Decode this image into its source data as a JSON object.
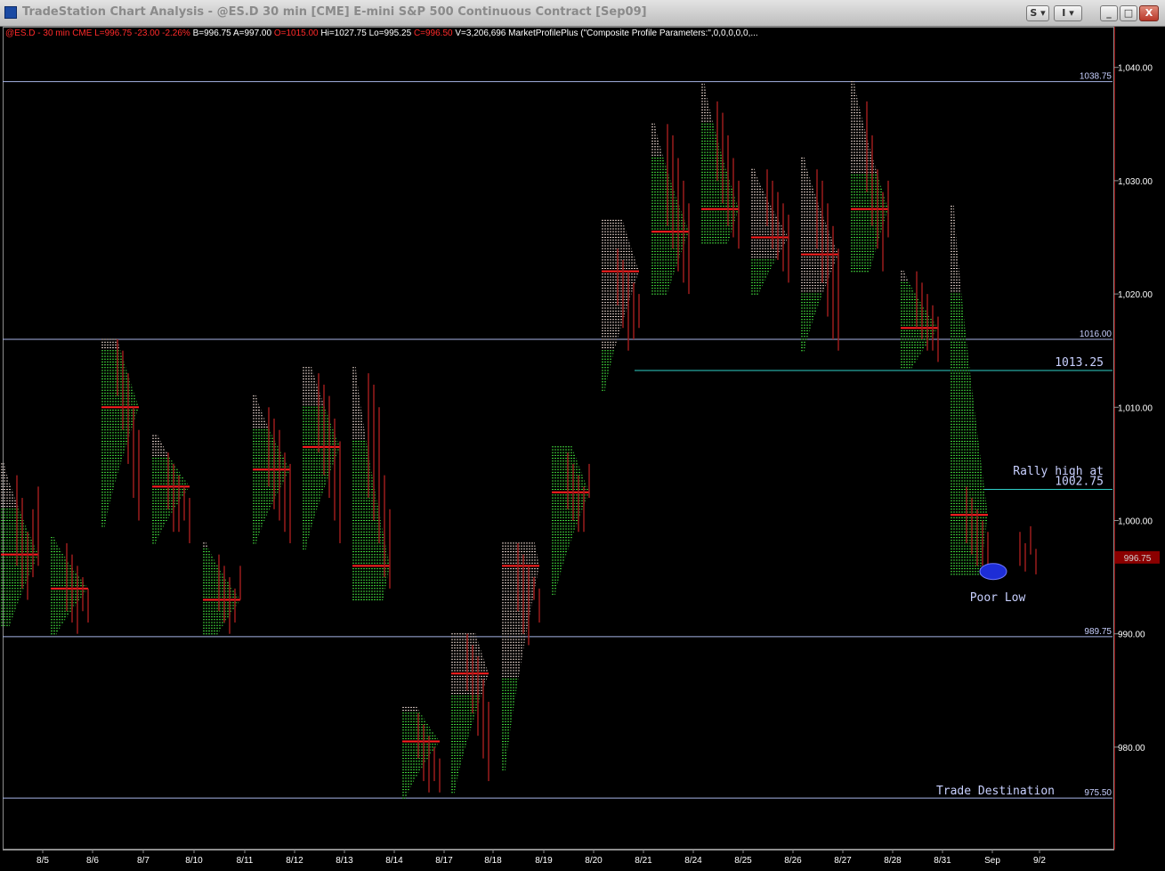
{
  "window": {
    "title": "TradeStation Chart Analysis - @ES.D 30 min [CME] E-mini S&P 500 Continuous Contract [Sep09]",
    "buttons": [
      "S",
      "I",
      "_",
      "□",
      "X"
    ]
  },
  "status": {
    "symbol": "@ES.D - 30 min",
    "exchange": "CME",
    "last": "L=996.75",
    "net_change": "-23.00",
    "pct_change": "-2.26%",
    "bid": "B=996.75",
    "ask": "A=997.00",
    "open": "O=1015.00",
    "high": "Hi=1027.75",
    "low": "Lo=995.25",
    "close": "C=996.50",
    "volume": "V=3,206,696",
    "study": "MarketProfilePlus (\"Composite Profile Parameters:\",0,0,0,0,0,..."
  },
  "colors": {
    "background": "#000000",
    "profile_green": "#3fd13a",
    "profile_white": "#d9c7c0",
    "bar": "#9b1c1c",
    "poc": "#ff2020",
    "level_line": "#a7b4e6",
    "teal_line": "#2fd0c8",
    "label": "#c8d0ff",
    "axis_text": "#ffffff",
    "last_price_marker": "#8b0000",
    "poor_low_circle": "#1d2dd6"
  },
  "chart_data": {
    "type": "market-profile",
    "instrument": "@ES.D 30 min E-mini S&P 500",
    "y_axis": {
      "ticks": [
        980,
        990,
        1000,
        1010,
        1020,
        1030,
        1040
      ],
      "tick_labels": [
        "980.00",
        "990.00",
        "1,000.00",
        "1,010.00",
        "1,020.00",
        "1,030.00",
        "1,040.00"
      ],
      "ylim": [
        972,
        1042.5
      ]
    },
    "x_axis": {
      "dates": [
        "8/5",
        "8/6",
        "8/7",
        "8/10",
        "8/11",
        "8/12",
        "8/13",
        "8/14",
        "8/17",
        "8/18",
        "8/19",
        "8/20",
        "8/21",
        "8/24",
        "8/25",
        "8/26",
        "8/27",
        "8/28",
        "8/31",
        "Sep",
        "9/2"
      ]
    },
    "sessions": [
      {
        "date": "8/5",
        "low": 990.75,
        "high": 1005.0,
        "poc": 997.0,
        "va": [
          993.5,
          1000.0
        ],
        "split": 1001.0,
        "bars": [
          [
            1004,
            996
          ],
          [
            1002,
            994
          ],
          [
            999,
            993
          ],
          [
            1001,
            995
          ],
          [
            1003,
            996
          ]
        ]
      },
      {
        "date": "8/6",
        "low": 990.0,
        "high": 998.5,
        "poc": 994.0,
        "va": [
          992.0,
          996.5
        ],
        "split": 998.5,
        "bars": [
          [
            998,
            992
          ],
          [
            997,
            991
          ],
          [
            996,
            990
          ],
          [
            995,
            992
          ],
          [
            994,
            991
          ]
        ]
      },
      {
        "date": "8/7",
        "low": 999.5,
        "high": 1016.0,
        "poc": 1010.0,
        "va": [
          1008.0,
          1014.0
        ],
        "split": 1015.0,
        "bars": [
          [
            1016,
            1011
          ],
          [
            1015,
            1008
          ],
          [
            1013,
            1005
          ],
          [
            1010,
            1002
          ],
          [
            1008,
            1000
          ]
        ]
      },
      {
        "date": "8/10",
        "low": 998.0,
        "high": 1007.5,
        "poc": 1003.0,
        "va": [
          1001.0,
          1005.5
        ],
        "split": 1005.5,
        "bars": [
          [
            1006,
            1001
          ],
          [
            1005,
            999
          ],
          [
            1004,
            999
          ],
          [
            1003,
            1000
          ],
          [
            1002,
            998
          ]
        ]
      },
      {
        "date": "8/11",
        "low": 990.0,
        "high": 998.0,
        "poc": 993.0,
        "va": [
          991.0,
          995.5
        ],
        "split": 997.5,
        "bars": [
          [
            997,
            992
          ],
          [
            996,
            991
          ],
          [
            995,
            990
          ],
          [
            994,
            991
          ],
          [
            996,
            993
          ]
        ]
      },
      {
        "date": "8/12",
        "low": 998.0,
        "high": 1011.0,
        "poc": 1004.5,
        "va": [
          1002.0,
          1007.0
        ],
        "split": 1008.0,
        "bars": [
          [
            1010,
            1003
          ],
          [
            1009,
            1001
          ],
          [
            1008,
            1000
          ],
          [
            1006,
            999
          ],
          [
            1005,
            998
          ]
        ]
      },
      {
        "date": "8/13",
        "low": 997.5,
        "high": 1013.5,
        "poc": 1006.5,
        "va": [
          1004.0,
          1009.5
        ],
        "split": 1010.0,
        "bars": [
          [
            1013,
            1006
          ],
          [
            1012,
            1004
          ],
          [
            1011,
            1002
          ],
          [
            1009,
            1000
          ],
          [
            1007,
            998
          ]
        ]
      },
      {
        "date": "8/14",
        "low": 993.0,
        "high": 1013.5,
        "poc": 996.0,
        "va": [
          994.5,
          998.0
        ],
        "split": 1007.0,
        "bars": [
          [
            1013,
            1002
          ],
          [
            1012,
            1000
          ],
          [
            1010,
            998
          ],
          [
            1004,
            995
          ],
          [
            1001,
            994
          ]
        ]
      },
      {
        "date": "8/17",
        "low": 975.5,
        "high": 983.5,
        "poc": 980.5,
        "va": [
          978.5,
          982.0
        ],
        "split": 983.0,
        "bars": [
          [
            983,
            979
          ],
          [
            982,
            977
          ],
          [
            981,
            976
          ],
          [
            980,
            977
          ],
          [
            979,
            976
          ]
        ]
      },
      {
        "date": "8/18",
        "low": 976.0,
        "high": 990.0,
        "poc": 986.5,
        "va": [
          984.5,
          989.0
        ],
        "split": 984.5,
        "bars": [
          [
            990,
            985
          ],
          [
            989,
            983
          ],
          [
            988,
            981
          ],
          [
            986,
            979
          ],
          [
            984,
            977
          ]
        ]
      },
      {
        "date": "8/19",
        "low": 978.0,
        "high": 998.0,
        "poc": 996.0,
        "va": [
          989.5,
          997.0
        ],
        "split": 986.0,
        "bars": [
          [
            998,
            992
          ],
          [
            997,
            990
          ],
          [
            996,
            989
          ],
          [
            995,
            993
          ],
          [
            994,
            991
          ]
        ]
      },
      {
        "date": "8/20",
        "low": 993.5,
        "high": 1006.5,
        "poc": 1002.5,
        "va": [
          1000.0,
          1004.5
        ],
        "split": 1007.0,
        "bars": [
          [
            1006,
            1001
          ],
          [
            1005,
            1000
          ],
          [
            1004,
            999
          ],
          [
            1003,
            999
          ],
          [
            1005,
            1002
          ]
        ]
      },
      {
        "date": "8/21",
        "low": 1011.5,
        "high": 1026.5,
        "poc": 1022.0,
        "va": [
          1019.0,
          1024.5
        ],
        "split": 1015.0,
        "bars": [
          [
            1024,
            1019
          ],
          [
            1023,
            1017
          ],
          [
            1022,
            1015
          ],
          [
            1021,
            1016
          ],
          [
            1020,
            1017
          ]
        ]
      },
      {
        "date": "8/24",
        "low": 1020.0,
        "high": 1035.0,
        "poc": 1025.5,
        "va": [
          1022.0,
          1031.0
        ],
        "split": 1032.0,
        "bars": [
          [
            1035,
            1026
          ],
          [
            1034,
            1024
          ],
          [
            1032,
            1022
          ],
          [
            1030,
            1021
          ],
          [
            1028,
            1020
          ]
        ]
      },
      {
        "date": "8/25",
        "low": 1024.5,
        "high": 1038.5,
        "poc": 1027.5,
        "va": [
          1025.5,
          1033.0
        ],
        "split": 1035.0,
        "bars": [
          [
            1037,
            1030
          ],
          [
            1036,
            1028
          ],
          [
            1034,
            1026
          ],
          [
            1032,
            1025
          ],
          [
            1030,
            1024
          ]
        ]
      },
      {
        "date": "8/26",
        "low": 1020.0,
        "high": 1031.0,
        "poc": 1025.0,
        "va": [
          1023.0,
          1029.0
        ],
        "split": 1023.0,
        "bars": [
          [
            1031,
            1026
          ],
          [
            1030,
            1024
          ],
          [
            1029,
            1023
          ],
          [
            1028,
            1022
          ],
          [
            1027,
            1021
          ]
        ]
      },
      {
        "date": "8/27",
        "low": 1015.0,
        "high": 1032.0,
        "poc": 1023.5,
        "va": [
          1019.0,
          1027.0
        ],
        "split": 1020.0,
        "bars": [
          [
            1031,
            1024
          ],
          [
            1030,
            1021
          ],
          [
            1028,
            1018
          ],
          [
            1026,
            1016
          ],
          [
            1024,
            1015
          ]
        ]
      },
      {
        "date": "8/28",
        "low": 1022.0,
        "high": 1038.75,
        "poc": 1027.5,
        "va": [
          1024.5,
          1030.0
        ],
        "split": 1030.5,
        "bars": [
          [
            1037,
            1029
          ],
          [
            1034,
            1026
          ],
          [
            1031,
            1024
          ],
          [
            1029,
            1022
          ],
          [
            1030,
            1025
          ]
        ]
      },
      {
        "date": "8/31",
        "low": 1013.5,
        "high": 1022.0,
        "poc": 1017.0,
        "va": [
          1015.0,
          1019.5
        ],
        "split": 1021.0,
        "bars": [
          [
            1022,
            1017
          ],
          [
            1021,
            1016
          ],
          [
            1020,
            1015
          ],
          [
            1019,
            1015
          ],
          [
            1018,
            1014
          ]
        ]
      },
      {
        "date": "Sep",
        "low": 995.25,
        "high": 1027.75,
        "poc": 1000.5,
        "va": [
          997.0,
          1003.0
        ],
        "split": 1020.0,
        "bars": [
          [
            1003,
            998
          ],
          [
            1002,
            997
          ],
          [
            1001,
            996
          ],
          [
            1000,
            996
          ],
          [
            999,
            995
          ]
        ]
      }
    ],
    "levels": [
      {
        "price": 1038.75,
        "label": "1038.75",
        "color": "level"
      },
      {
        "price": 1016.0,
        "label": "1016.00",
        "color": "level"
      },
      {
        "price": 1013.25,
        "label": "1013.25",
        "color": "teal",
        "from": "8/21"
      },
      {
        "price": 1002.75,
        "label": "1002.75",
        "color": "teal",
        "from": "Sep"
      },
      {
        "price": 989.75,
        "label": "989.75",
        "color": "level"
      },
      {
        "price": 975.5,
        "label": "975.50",
        "color": "level"
      }
    ],
    "annotations": {
      "rally_high_text": "Rally high at",
      "trade_destination": "Trade Destination",
      "poor_low": "Poor Low",
      "last_price": "996.75"
    }
  }
}
